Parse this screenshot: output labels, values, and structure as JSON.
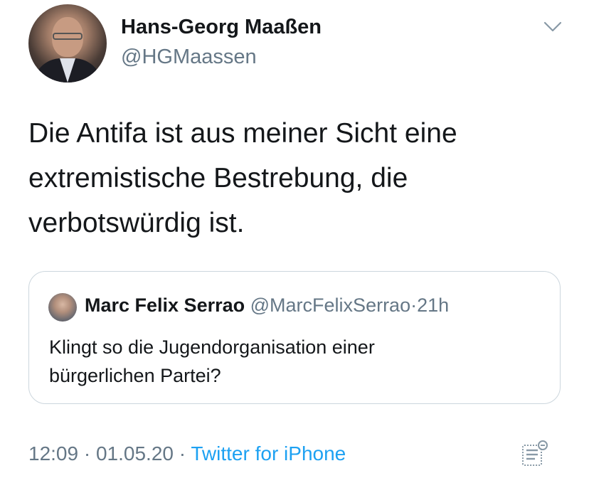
{
  "author": {
    "name": "Hans-Georg Maaßen",
    "handle": "@HGMaassen"
  },
  "tweet": {
    "text_lines": [
      "Die Antifa ist aus meiner Sicht eine",
      "extremistische Bestrebung, die",
      "verbotswürdig ist."
    ]
  },
  "quoted_tweet": {
    "name": "Marc Felix Serrao",
    "handle": "@MarcFelixSerrao",
    "separator": "·",
    "time": "21h",
    "text_lines": [
      "Klingt so die Jugendorganisation einer",
      "bürgerlichen Partei?"
    ]
  },
  "meta": {
    "time": "12:09",
    "separator": "·",
    "date": "01.05.20",
    "source": "Twitter for iPhone"
  },
  "icons": {
    "menu": "chevron-down-icon",
    "analytics": "view-activity-icon"
  },
  "colors": {
    "text": "#14171a",
    "muted": "#657786",
    "link": "#1da1f2",
    "border": "#ccd6dd"
  }
}
